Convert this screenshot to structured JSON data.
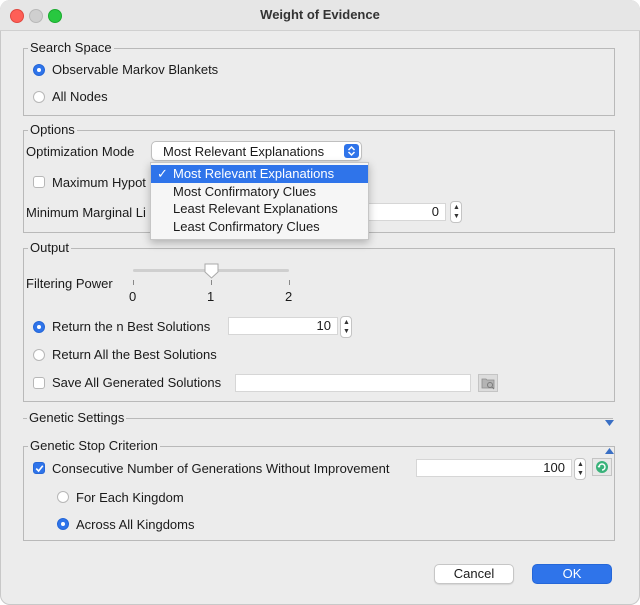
{
  "window": {
    "title": "Weight of Evidence"
  },
  "search_space": {
    "legend": "Search Space",
    "options": [
      {
        "label": "Observable Markov Blankets",
        "selected": true
      },
      {
        "label": "All Nodes",
        "selected": false
      }
    ]
  },
  "options": {
    "legend": "Options",
    "optimization_mode_label": "Optimization Mode",
    "optimization_mode_value": "Most Relevant Explanations",
    "dropdown_items": [
      {
        "label": "Most Relevant Explanations",
        "selected": true,
        "check": "✓"
      },
      {
        "label": "Most Confirmatory Clues",
        "selected": false
      },
      {
        "label": "Least Relevant Explanations",
        "selected": false
      },
      {
        "label": "Least Confirmatory Clues",
        "selected": false
      }
    ],
    "maximum_label": "Maximum Hypot",
    "maximum_checked": false,
    "min_marginal_label": "Minimum Marginal Li",
    "min_marginal_value": "0"
  },
  "output": {
    "legend": "Output",
    "filtering_power_label": "Filtering Power",
    "slider_ticks": [
      "0",
      "1",
      "2"
    ],
    "slider_value": 1,
    "return_n_label": "Return the n Best Solutions",
    "return_n_selected": true,
    "return_n_value": "10",
    "return_all_label": "Return All the Best Solutions",
    "return_all_selected": false,
    "save_all_label": "Save All Generated Solutions",
    "save_all_checked": false,
    "save_path": ""
  },
  "genetic_settings": {
    "legend": "Genetic Settings",
    "collapsed": true
  },
  "genetic_stop": {
    "legend": "Genetic Stop Criterion",
    "consecutive_label": "Consecutive Number of Generations Without Improvement",
    "consecutive_checked": true,
    "consecutive_value": "100",
    "kingdom_options": [
      {
        "label": "For Each Kingdom",
        "selected": false
      },
      {
        "label": "Across All Kingdoms",
        "selected": true
      }
    ]
  },
  "buttons": {
    "cancel": "Cancel",
    "ok": "OK"
  },
  "colors": {
    "accent": "#2f74ea",
    "background": "#ececec",
    "close": "#fe5f57",
    "zoom": "#28c840"
  },
  "icons": [
    "close-window-icon",
    "minimize-window-icon",
    "zoom-window-icon",
    "folder-browse-icon",
    "refresh-icon",
    "checkmark-icon",
    "up-down-arrows-icon",
    "collapse-triangle-icon"
  ]
}
